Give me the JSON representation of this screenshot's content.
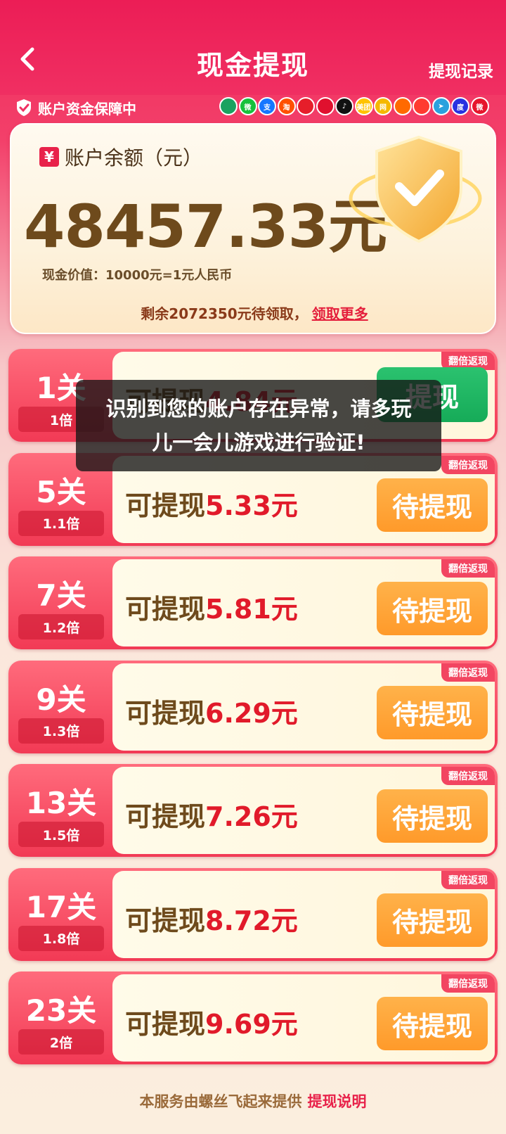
{
  "header": {
    "title": "现金提现",
    "record_link": "提现记录"
  },
  "guard": {
    "text": "账户资金保障中"
  },
  "partners": [
    {
      "name": "app-icon-1",
      "color": "#1aa260",
      "glyph": ""
    },
    {
      "name": "wechat-icon",
      "color": "#17c13c",
      "glyph": "微"
    },
    {
      "name": "alipay-icon",
      "color": "#1677ff",
      "glyph": "支"
    },
    {
      "name": "taobao-icon",
      "color": "#ff5000",
      "glyph": "淘"
    },
    {
      "name": "app-icon-5",
      "color": "#e61e2a",
      "glyph": ""
    },
    {
      "name": "app-icon-6",
      "color": "#e0102e",
      "glyph": ""
    },
    {
      "name": "douyin-icon",
      "color": "#111111",
      "glyph": "♪"
    },
    {
      "name": "meituan-icon",
      "color": "#ffc300",
      "glyph": "美团"
    },
    {
      "name": "app-icon-9",
      "color": "#f5b800",
      "glyph": "网"
    },
    {
      "name": "app-icon-10",
      "color": "#ff6a00",
      "glyph": ""
    },
    {
      "name": "app-icon-11",
      "color": "#ff3b30",
      "glyph": ""
    },
    {
      "name": "telegram-icon",
      "color": "#2aa1de",
      "glyph": "➤"
    },
    {
      "name": "baidu-icon",
      "color": "#2932e1",
      "glyph": "度"
    },
    {
      "name": "weibo-icon",
      "color": "#e6162d",
      "glyph": "微"
    }
  ],
  "balance": {
    "label": "账户余额（元）",
    "amount": "48457.33元",
    "rate": "现金价值：10000元=1元人民币",
    "remain": "剩余2072350元待领取，",
    "more_link": "领取更多"
  },
  "levels": [
    {
      "name": "1关",
      "multiplier": "1倍",
      "tag": "翻倍返现",
      "label": "可提现",
      "amount": "4.84元",
      "button": "提现",
      "state": "ready"
    },
    {
      "name": "5关",
      "multiplier": "1.1倍",
      "tag": "翻倍返现",
      "label": "可提现",
      "amount": "5.33元",
      "button": "待提现",
      "state": "pending"
    },
    {
      "name": "7关",
      "multiplier": "1.2倍",
      "tag": "翻倍返现",
      "label": "可提现",
      "amount": "5.81元",
      "button": "待提现",
      "state": "pending"
    },
    {
      "name": "9关",
      "multiplier": "1.3倍",
      "tag": "翻倍返现",
      "label": "可提现",
      "amount": "6.29元",
      "button": "待提现",
      "state": "pending"
    },
    {
      "name": "13关",
      "multiplier": "1.5倍",
      "tag": "翻倍返现",
      "label": "可提现",
      "amount": "7.26元",
      "button": "待提现",
      "state": "pending"
    },
    {
      "name": "17关",
      "multiplier": "1.8倍",
      "tag": "翻倍返现",
      "label": "可提现",
      "amount": "8.72元",
      "button": "待提现",
      "state": "pending"
    },
    {
      "name": "23关",
      "multiplier": "2倍",
      "tag": "翻倍返现",
      "label": "可提现",
      "amount": "9.69元",
      "button": "待提现",
      "state": "pending"
    }
  ],
  "toast": {
    "line1": "识别到您的账户存在异常，请多玩",
    "line2": "儿一会儿游戏进行验证!"
  },
  "footer": {
    "text": "本服务由螺丝飞起来提供",
    "link": "提现说明"
  }
}
